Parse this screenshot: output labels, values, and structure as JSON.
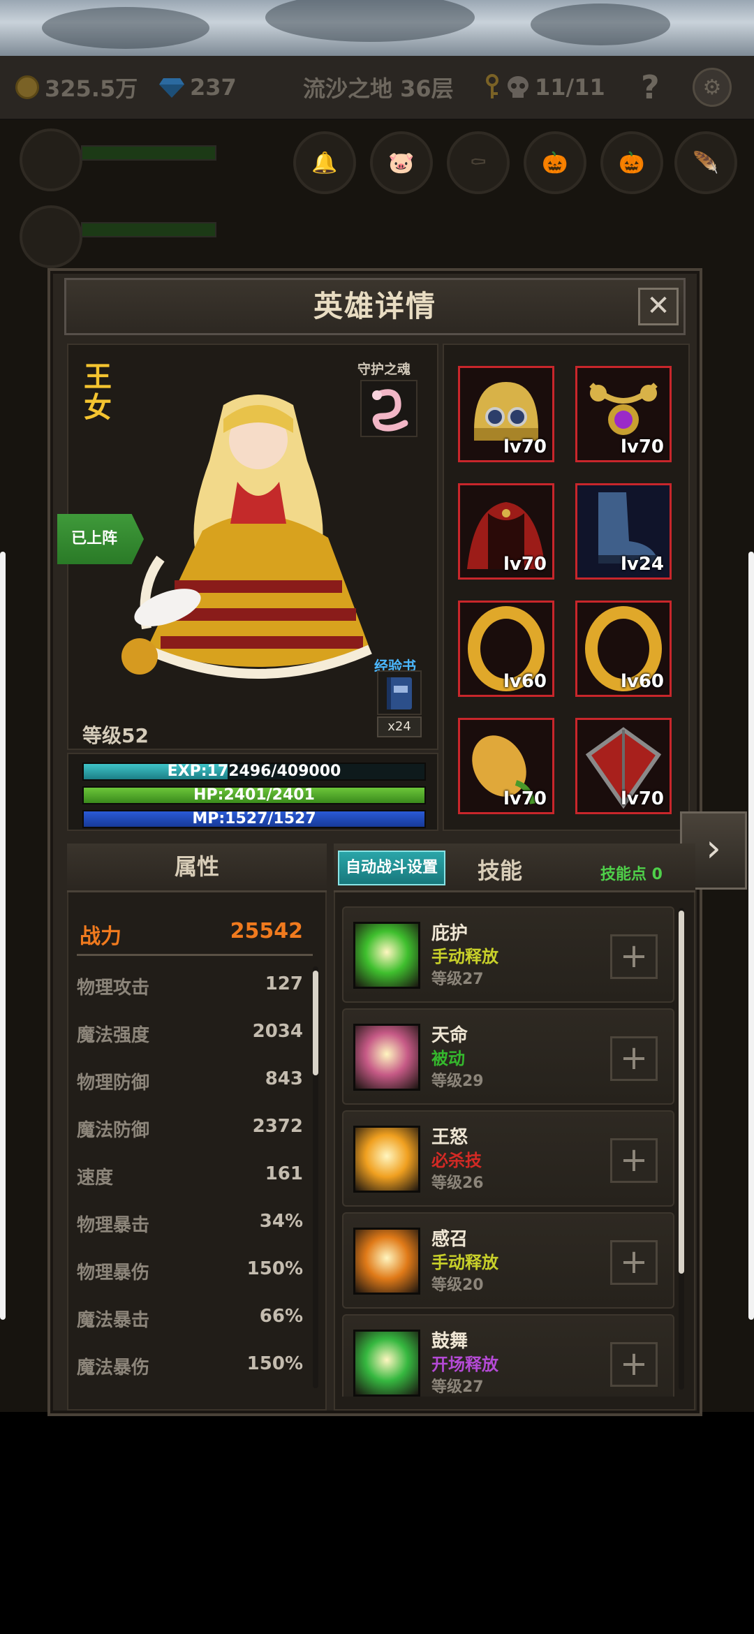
{
  "topbar": {
    "gold": "325.5万",
    "gems": "237",
    "location": "流沙之地 36层",
    "keys_skulls": "11/11",
    "help": "?"
  },
  "dialog": {
    "title": "英雄详情",
    "close": "✕"
  },
  "hero": {
    "name": "王女",
    "guardian_label": "守护之魂",
    "status_tag": "已上阵",
    "exp_book_label": "经验书",
    "exp_book_count": "x24",
    "level": "等级52",
    "exp_text": "EXP:172496/409000",
    "exp_fraction": 0.4217,
    "hp_text": "HP:2401/2401",
    "hp_fraction": 1.0,
    "mp_text": "MP:1527/1527",
    "mp_fraction": 1.0
  },
  "equipment": [
    {
      "icon": "golden-helmet-icon",
      "level": "lv70"
    },
    {
      "icon": "gem-necklace-icon",
      "level": "lv70"
    },
    {
      "icon": "red-cape-icon",
      "level": "lv70"
    },
    {
      "icon": "boots-icon",
      "level": "lv24"
    },
    {
      "icon": "gold-ring-icon",
      "level": "lv60"
    },
    {
      "icon": "gold-ring-icon",
      "level": "lv60"
    },
    {
      "icon": "gourd-charm-icon",
      "level": "lv70"
    },
    {
      "icon": "red-shield-icon",
      "level": "lv70"
    }
  ],
  "attributes": {
    "header": "属性",
    "power_label": "战力",
    "power_value": "25542",
    "rows": [
      {
        "label": "物理攻击",
        "value": "127"
      },
      {
        "label": "魔法强度",
        "value": "2034"
      },
      {
        "label": "物理防御",
        "value": "843"
      },
      {
        "label": "魔法防御",
        "value": "2372"
      },
      {
        "label": "速度",
        "value": "161"
      },
      {
        "label": "物理暴击",
        "value": "34%"
      },
      {
        "label": "物理暴伤",
        "value": "150%"
      },
      {
        "label": "魔法暴击",
        "value": "66%"
      },
      {
        "label": "魔法暴伤",
        "value": "150%"
      }
    ]
  },
  "skills": {
    "auto_battle_button": "自动战斗设置",
    "header": "技能",
    "points": "技能点 0",
    "list": [
      {
        "name": "庇护",
        "type": "手动释放",
        "type_color": "#c9d12a",
        "level": "等级27",
        "icon_color": "#3fbf2e"
      },
      {
        "name": "天命",
        "type": "被动",
        "type_color": "#35b82d",
        "level": "等级29",
        "icon_color": "#c65a86"
      },
      {
        "name": "王怒",
        "type": "必杀技",
        "type_color": "#d32a25",
        "level": "等级26",
        "icon_color": "#f0a020"
      },
      {
        "name": "感召",
        "type": "手动释放",
        "type_color": "#c9d12a",
        "level": "等级20",
        "icon_color": "#e07a18"
      },
      {
        "name": "鼓舞",
        "type": "开场释放",
        "type_color": "#b54ad6",
        "level": "等级27",
        "icon_color": "#36b840"
      }
    ]
  }
}
